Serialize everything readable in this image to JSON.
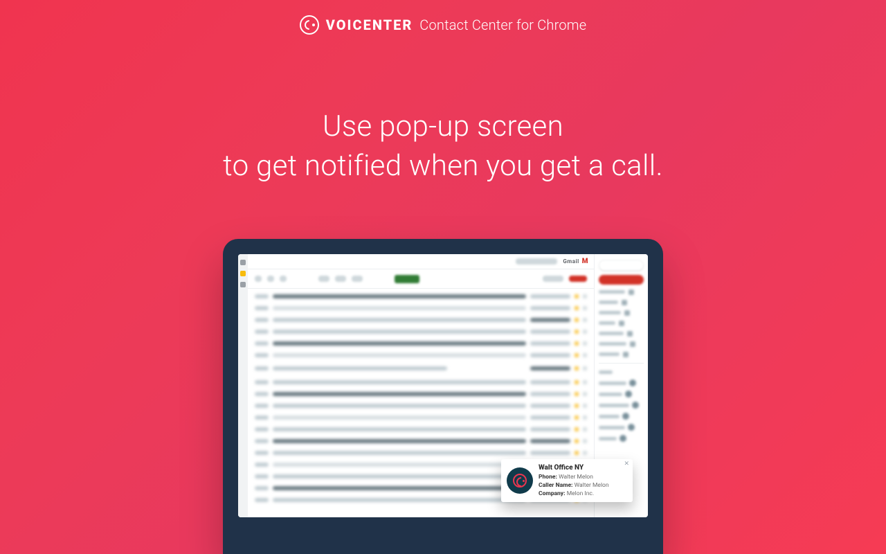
{
  "brand": {
    "name": "VOICENTER",
    "subtitle": "Contact Center for Chrome"
  },
  "hero": {
    "line1": "Use pop-up screen",
    "line2": "to get notified when you get a call."
  },
  "gmail": {
    "product_label": "Gmail"
  },
  "popup": {
    "title": "Walt Office NY",
    "fields": [
      {
        "label": "Phone:",
        "value": "Walter Melon"
      },
      {
        "label": "Caller Name:",
        "value": "Walter Melon"
      },
      {
        "label": "Company:",
        "value": "Melon Inc."
      }
    ]
  },
  "colors": {
    "accent": "#f0344f",
    "monitor_frame": "#203249",
    "popup_avatar_bg": "#0e3b4c"
  }
}
